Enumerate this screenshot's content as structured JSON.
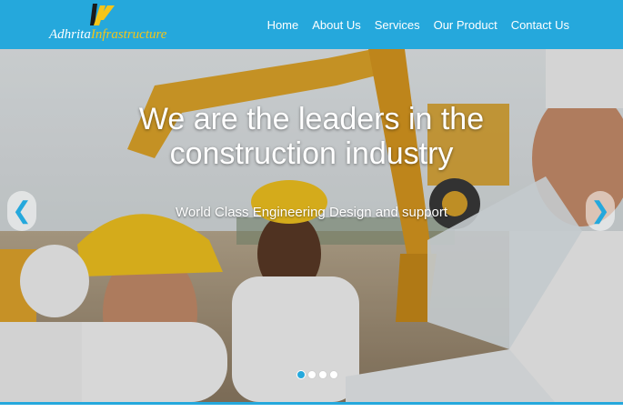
{
  "brand": {
    "name_part1": "Adhrita",
    "name_part2": "Infrastructure",
    "colors": {
      "primary": "#25a8dc",
      "accent": "#f5c518"
    }
  },
  "nav": {
    "items": [
      {
        "label": "Home"
      },
      {
        "label": "About Us"
      },
      {
        "label": "Services"
      },
      {
        "label": "Our Product"
      },
      {
        "label": "Contact Us"
      }
    ]
  },
  "hero": {
    "headline_line1": "We are the leaders in the",
    "headline_line2": "construction industry",
    "subheadline": "World Class Engineering Design and support",
    "prev_icon": "❮",
    "next_icon": "❯",
    "slides_count": 4,
    "active_slide": 1
  }
}
